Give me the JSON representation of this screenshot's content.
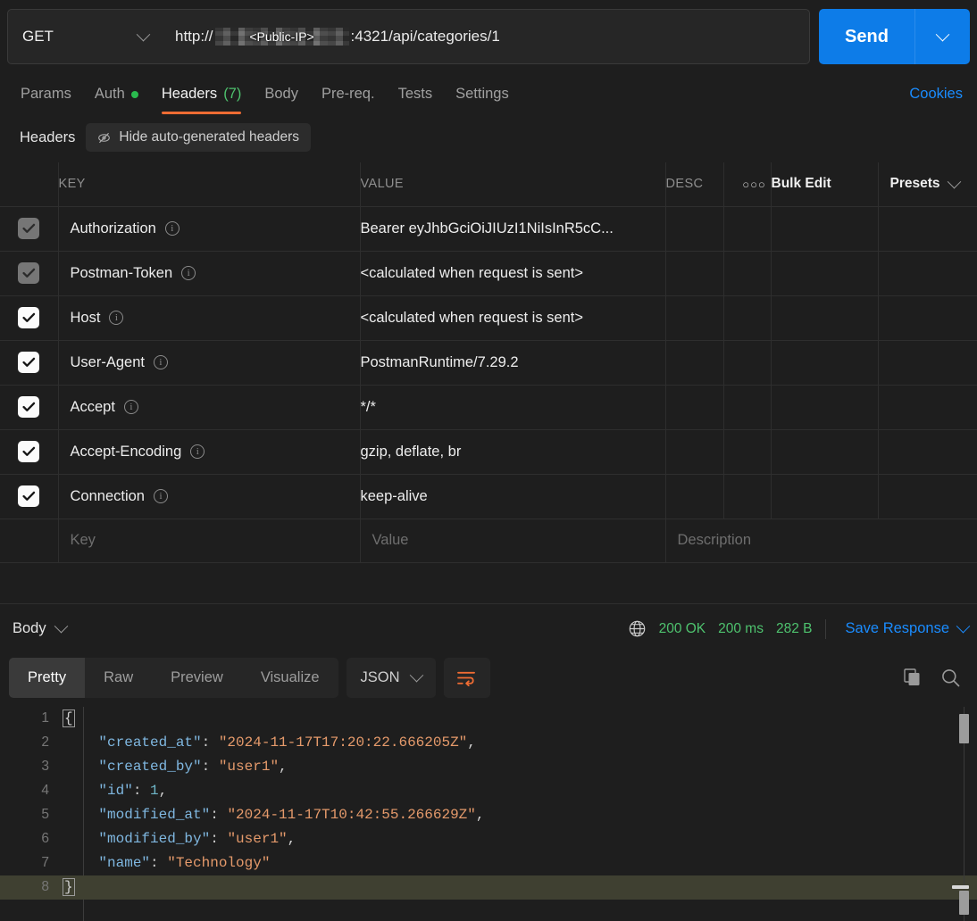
{
  "request": {
    "method": "GET",
    "url_prefix": "http://",
    "url_redacted_label": "<Public-IP>",
    "url_suffix": ":4321/api/categories/1",
    "send_label": "Send"
  },
  "request_tabs": [
    {
      "label": "Params",
      "active": false,
      "dot": false,
      "count": ""
    },
    {
      "label": "Auth",
      "active": false,
      "dot": true,
      "count": ""
    },
    {
      "label": "Headers",
      "active": true,
      "dot": false,
      "count": "(7)"
    },
    {
      "label": "Body",
      "active": false,
      "dot": false,
      "count": ""
    },
    {
      "label": "Pre-req.",
      "active": false,
      "dot": false,
      "count": ""
    },
    {
      "label": "Tests",
      "active": false,
      "dot": false,
      "count": ""
    },
    {
      "label": "Settings",
      "active": false,
      "dot": false,
      "count": ""
    }
  ],
  "cookies_link": "Cookies",
  "headers_section": {
    "title": "Headers",
    "hide_auto_label": "Hide auto-generated headers",
    "columns": {
      "key": "KEY",
      "value": "VALUE",
      "desc": "DESC",
      "bulk_edit": "Bulk Edit",
      "presets": "Presets"
    },
    "rows": [
      {
        "checked": true,
        "dim": true,
        "key": "Authorization",
        "value": "Bearer eyJhbGciOiJIUzI1NiIsInR5cC..."
      },
      {
        "checked": true,
        "dim": true,
        "key": "Postman-Token",
        "value": "<calculated when request is sent>"
      },
      {
        "checked": true,
        "dim": false,
        "key": "Host",
        "value": "<calculated when request is sent>"
      },
      {
        "checked": true,
        "dim": false,
        "key": "User-Agent",
        "value": "PostmanRuntime/7.29.2"
      },
      {
        "checked": true,
        "dim": false,
        "key": "Accept",
        "value": "*/*"
      },
      {
        "checked": true,
        "dim": false,
        "key": "Accept-Encoding",
        "value": "gzip, deflate, br"
      },
      {
        "checked": true,
        "dim": false,
        "key": "Connection",
        "value": "keep-alive"
      }
    ],
    "new_row": {
      "key_placeholder": "Key",
      "value_placeholder": "Value",
      "desc_placeholder": "Description"
    }
  },
  "response": {
    "body_label": "Body",
    "status_code": "200 OK",
    "time": "200 ms",
    "size": "282 B",
    "save_response_label": "Save Response",
    "tabs": [
      {
        "label": "Pretty",
        "active": true
      },
      {
        "label": "Raw",
        "active": false
      },
      {
        "label": "Preview",
        "active": false
      },
      {
        "label": "Visualize",
        "active": false
      }
    ],
    "format": "JSON",
    "code_lines": [
      {
        "n": "1",
        "highlight": false,
        "segments": [
          {
            "t": "{",
            "c": "p brace-box"
          }
        ]
      },
      {
        "n": "2",
        "highlight": false,
        "segments": [
          {
            "t": "    ",
            "c": "p"
          },
          {
            "t": "\"created_at\"",
            "c": "k"
          },
          {
            "t": ": ",
            "c": "p"
          },
          {
            "t": "\"2024-11-17T17:20:22.666205Z\"",
            "c": "s"
          },
          {
            "t": ",",
            "c": "p"
          }
        ]
      },
      {
        "n": "3",
        "highlight": false,
        "segments": [
          {
            "t": "    ",
            "c": "p"
          },
          {
            "t": "\"created_by\"",
            "c": "k"
          },
          {
            "t": ": ",
            "c": "p"
          },
          {
            "t": "\"user1\"",
            "c": "s"
          },
          {
            "t": ",",
            "c": "p"
          }
        ]
      },
      {
        "n": "4",
        "highlight": false,
        "segments": [
          {
            "t": "    ",
            "c": "p"
          },
          {
            "t": "\"id\"",
            "c": "k"
          },
          {
            "t": ": ",
            "c": "p"
          },
          {
            "t": "1",
            "c": "n"
          },
          {
            "t": ",",
            "c": "p"
          }
        ]
      },
      {
        "n": "5",
        "highlight": false,
        "segments": [
          {
            "t": "    ",
            "c": "p"
          },
          {
            "t": "\"modified_at\"",
            "c": "k"
          },
          {
            "t": ": ",
            "c": "p"
          },
          {
            "t": "\"2024-11-17T10:42:55.266629Z\"",
            "c": "s"
          },
          {
            "t": ",",
            "c": "p"
          }
        ]
      },
      {
        "n": "6",
        "highlight": false,
        "segments": [
          {
            "t": "    ",
            "c": "p"
          },
          {
            "t": "\"modified_by\"",
            "c": "k"
          },
          {
            "t": ": ",
            "c": "p"
          },
          {
            "t": "\"user1\"",
            "c": "s"
          },
          {
            "t": ",",
            "c": "p"
          }
        ]
      },
      {
        "n": "7",
        "highlight": false,
        "segments": [
          {
            "t": "    ",
            "c": "p"
          },
          {
            "t": "\"name\"",
            "c": "k"
          },
          {
            "t": ": ",
            "c": "p"
          },
          {
            "t": "\"Technology\"",
            "c": "s"
          }
        ]
      },
      {
        "n": "8",
        "highlight": true,
        "segments": [
          {
            "t": "}",
            "c": "p brace-box"
          }
        ]
      }
    ]
  },
  "colors": {
    "accent_orange": "#ef6c33",
    "link_blue": "#1a8cff",
    "send_blue": "#0d7ce8",
    "status_green": "#4ec26e",
    "background": "#1e1e1e"
  }
}
